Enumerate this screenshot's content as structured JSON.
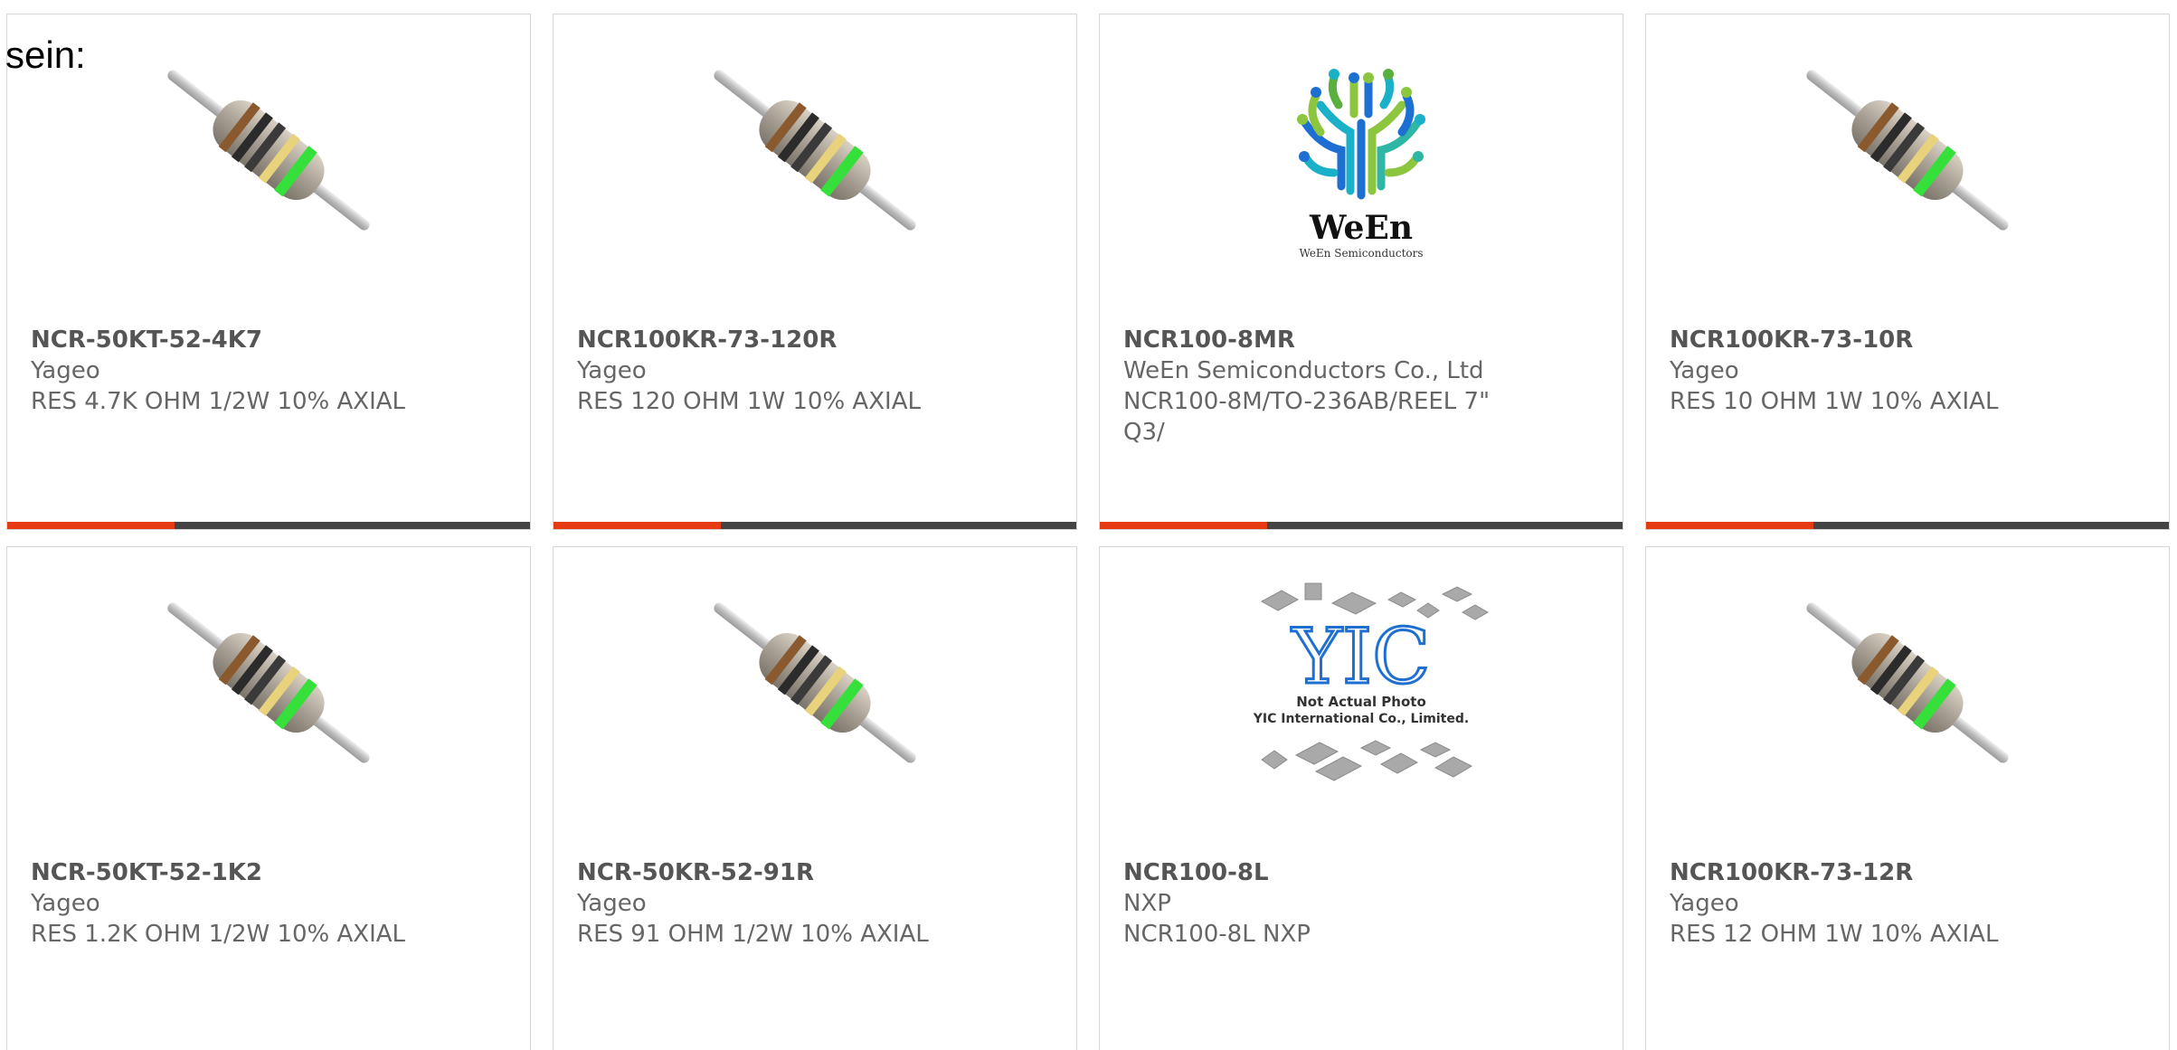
{
  "intro_text": "sein:",
  "accent_color": "#e63a12",
  "cards": [
    {
      "part": "NCR-50KT-52-4K7",
      "maker": "Yageo",
      "desc": "RES 4.7K OHM 1/2W 10% AXIAL",
      "image": "resistor",
      "progress": 0.32
    },
    {
      "part": "NCR100KR-73-120R",
      "maker": "Yageo",
      "desc": "RES 120 OHM 1W 10% AXIAL",
      "image": "resistor",
      "progress": 0.32
    },
    {
      "part": "NCR100-8MR",
      "maker": "WeEn Semiconductors Co., Ltd",
      "desc": "NCR100-8M/TO-236AB/REEL 7\" Q3/",
      "image": "ween-logo",
      "logo_text": "WeEn",
      "logo_sub": "WeEn Semiconductors",
      "progress": 0.32
    },
    {
      "part": "NCR100KR-73-10R",
      "maker": "Yageo",
      "desc": "RES 10 OHM 1W 10% AXIAL",
      "image": "resistor",
      "progress": 0.32
    },
    {
      "part": "NCR-50KT-52-1K2",
      "maker": "Yageo",
      "desc": "RES 1.2K OHM 1/2W 10% AXIAL",
      "image": "resistor"
    },
    {
      "part": "NCR-50KR-52-91R",
      "maker": "Yageo",
      "desc": "RES 91 OHM 1/2W 10% AXIAL",
      "image": "resistor"
    },
    {
      "part": "NCR100-8L",
      "maker": "NXP",
      "desc": "NCR100-8L NXP",
      "image": "yic-placeholder",
      "logo_text": "YIC",
      "note_line1": "Not Actual Photo",
      "note_line2": "YIC International Co., Limited."
    },
    {
      "part": "NCR100KR-73-12R",
      "maker": "Yageo",
      "desc": "RES 12 OHM 1W 10% AXIAL",
      "image": "resistor"
    }
  ]
}
